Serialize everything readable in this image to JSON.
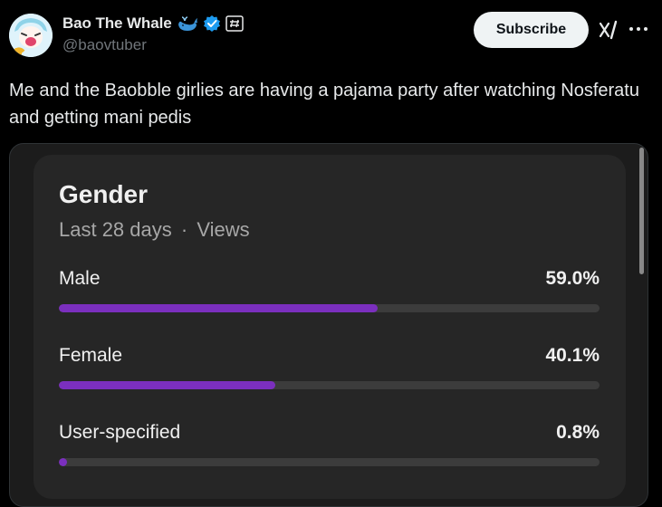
{
  "author": {
    "display_name": "Bao The Whale",
    "handle": "@baovtuber",
    "name_emoji_icon": "whale-emoji",
    "verified_icon": "verified-badge",
    "label_icon": "subscriber-label"
  },
  "actions": {
    "subscribe_label": "Subscribe",
    "grok_icon": "grok-icon",
    "more_icon": "more-icon"
  },
  "post": {
    "text": "Me and the Baobble girlies are having a pajama party after watching Nosferatu and getting mani pedis"
  },
  "card": {
    "title": "Gender",
    "period": "Last 28 days",
    "separator": "·",
    "metric": "Views",
    "rows": [
      {
        "label": "Male",
        "value": "59.0%",
        "fraction": 0.59
      },
      {
        "label": "Female",
        "value": "40.1%",
        "fraction": 0.401
      },
      {
        "label": "User-specified",
        "value": "0.8%",
        "fraction": 0.008
      }
    ]
  },
  "colors": {
    "bar_fill": "#7b2fbe",
    "bar_track": "#3c3c3c",
    "verified": "#1d9bf0"
  }
}
